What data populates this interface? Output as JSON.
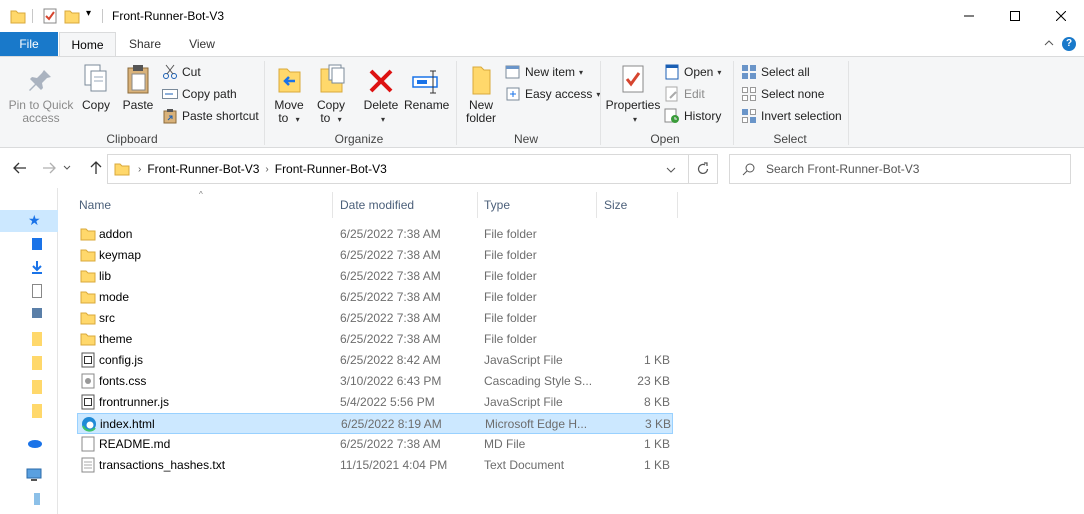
{
  "window": {
    "title": "Front-Runner-Bot-V3"
  },
  "ribbon_tabs": [
    "File",
    "Home",
    "Share",
    "View"
  ],
  "ribbon": {
    "clipboard": {
      "pin": [
        "Pin to Quick",
        "access"
      ],
      "copy": "Copy",
      "paste": "Paste",
      "cut": "Cut",
      "copy_path": "Copy path",
      "paste_shortcut": "Paste shortcut",
      "label": "Clipboard"
    },
    "organize": {
      "move_to": [
        "Move",
        "to"
      ],
      "copy_to": [
        "Copy",
        "to"
      ],
      "delete": "Delete",
      "rename": "Rename",
      "label": "Organize"
    },
    "new": {
      "new_folder": [
        "New",
        "folder"
      ],
      "new_item": "New item",
      "easy_access": "Easy access",
      "label": "New"
    },
    "open": {
      "properties": "Properties",
      "open": "Open",
      "edit": "Edit",
      "history": "History",
      "label": "Open"
    },
    "select": {
      "select_all": "Select all",
      "select_none": "Select none",
      "invert": "Invert selection",
      "label": "Select"
    }
  },
  "address": {
    "crumbs": [
      "Front-Runner-Bot-V3",
      "Front-Runner-Bot-V3"
    ],
    "search_placeholder": "Search Front-Runner-Bot-V3"
  },
  "columns": {
    "name": "Name",
    "date": "Date modified",
    "type": "Type",
    "size": "Size"
  },
  "files": [
    {
      "name": "addon",
      "date": "6/25/2022 7:38 AM",
      "type": "File folder",
      "size": "",
      "icon": "folder-icon"
    },
    {
      "name": "keymap",
      "date": "6/25/2022 7:38 AM",
      "type": "File folder",
      "size": "",
      "icon": "folder-icon"
    },
    {
      "name": "lib",
      "date": "6/25/2022 7:38 AM",
      "type": "File folder",
      "size": "",
      "icon": "folder-icon"
    },
    {
      "name": "mode",
      "date": "6/25/2022 7:38 AM",
      "type": "File folder",
      "size": "",
      "icon": "folder-icon"
    },
    {
      "name": "src",
      "date": "6/25/2022 7:38 AM",
      "type": "File folder",
      "size": "",
      "icon": "folder-icon"
    },
    {
      "name": "theme",
      "date": "6/25/2022 7:38 AM",
      "type": "File folder",
      "size": "",
      "icon": "folder-icon"
    },
    {
      "name": "config.js",
      "date": "6/25/2022 8:42 AM",
      "type": "JavaScript File",
      "size": "1 KB",
      "icon": "js-file-icon"
    },
    {
      "name": "fonts.css",
      "date": "3/10/2022 6:43 PM",
      "type": "Cascading Style S...",
      "size": "23 KB",
      "icon": "css-file-icon"
    },
    {
      "name": "frontrunner.js",
      "date": "5/4/2022 5:56 PM",
      "type": "JavaScript File",
      "size": "8 KB",
      "icon": "js-file-icon"
    },
    {
      "name": "index.html",
      "date": "6/25/2022 8:19 AM",
      "type": "Microsoft Edge H...",
      "size": "3 KB",
      "icon": "edge-html-icon",
      "selected": true
    },
    {
      "name": "README.md",
      "date": "6/25/2022 7:38 AM",
      "type": "MD File",
      "size": "1 KB",
      "icon": "md-file-icon"
    },
    {
      "name": "transactions_hashes.txt",
      "date": "11/15/2021 4:04 PM",
      "type": "Text Document",
      "size": "1 KB",
      "icon": "txt-file-icon"
    }
  ]
}
